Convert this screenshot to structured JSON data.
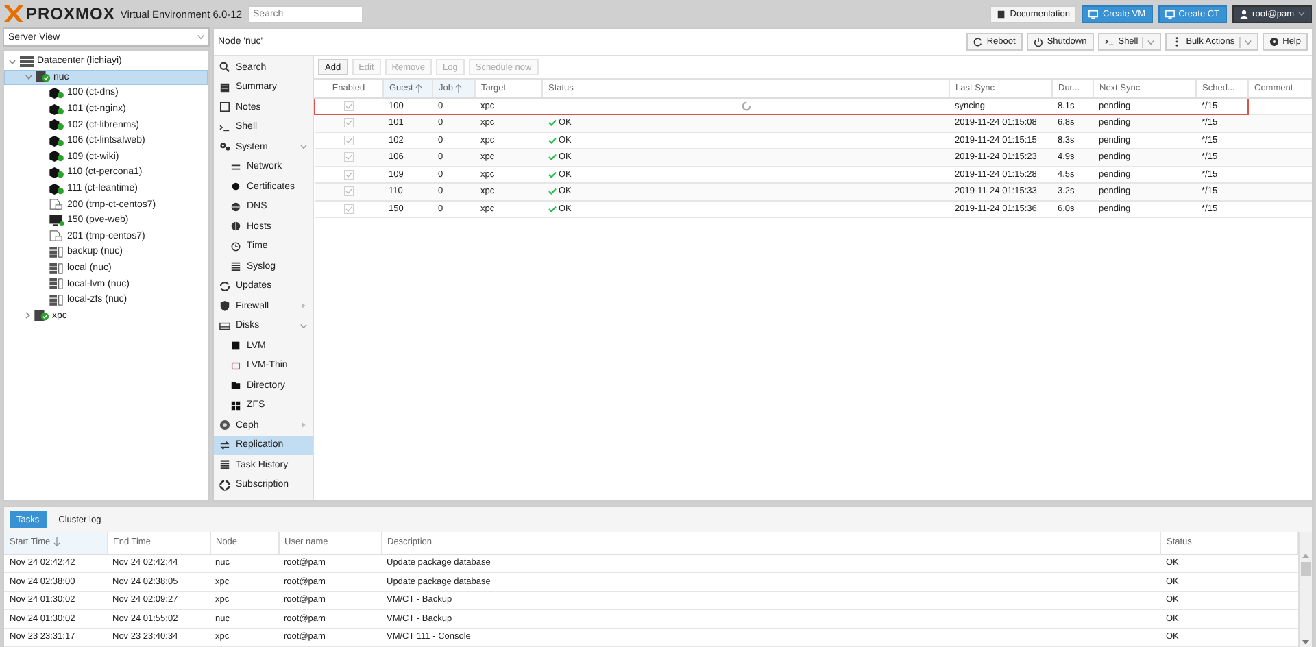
{
  "header": {
    "logo": "PROXMOX",
    "product": "Virtual Environment 6.0-12",
    "search": {
      "placeholder": "Search"
    },
    "buttons": [
      {
        "label": "Documentation",
        "kind": "plain"
      },
      {
        "label": "Create VM",
        "kind": "primary"
      },
      {
        "label": "Create CT",
        "kind": "primary"
      },
      {
        "label": "root@pam",
        "kind": "user"
      }
    ]
  },
  "tree": {
    "view": "Server View",
    "items": [
      {
        "label": "Datacenter (lichiayi)",
        "kind": "datacenter",
        "expanded": true,
        "selected": false,
        "children": [
          {
            "label": "nuc",
            "kind": "node",
            "expanded": true,
            "selected": true,
            "children": [
              {
                "label": "100 (ct-dns)",
                "kind": "ct",
                "selected": false
              },
              {
                "label": "101 (ct-nginx)",
                "kind": "ct",
                "selected": false
              },
              {
                "label": "102 (ct-librenms)",
                "kind": "ct",
                "selected": false
              },
              {
                "label": "106 (ct-lintsalweb)",
                "kind": "ct",
                "selected": false
              },
              {
                "label": "109 (ct-wiki)",
                "kind": "ct",
                "selected": false
              },
              {
                "label": "110 (ct-percona1)",
                "kind": "ct",
                "selected": false
              },
              {
                "label": "111 (ct-leantime)",
                "kind": "ct",
                "selected": false
              },
              {
                "label": "200 (tmp-ct-centos7)",
                "kind": "template",
                "selected": false
              },
              {
                "label": "150 (pve-web)",
                "kind": "vm",
                "selected": false
              },
              {
                "label": "201 (tmp-centos7)",
                "kind": "template",
                "selected": false
              },
              {
                "label": "backup (nuc)",
                "kind": "storage",
                "selected": false
              },
              {
                "label": "local (nuc)",
                "kind": "storage",
                "selected": false
              },
              {
                "label": "local-lvm (nuc)",
                "kind": "storage",
                "selected": false
              },
              {
                "label": "local-zfs (nuc)",
                "kind": "storage",
                "selected": false
              }
            ]
          },
          {
            "label": "xpc",
            "kind": "node",
            "expanded": false,
            "selected": false
          }
        ]
      }
    ]
  },
  "node": {
    "title": "Node 'nuc'",
    "buttons": [
      {
        "label": "Reboot",
        "menu": false
      },
      {
        "label": "Shutdown",
        "menu": false
      },
      {
        "label": "Shell",
        "menu": true
      },
      {
        "label": "Bulk Actions",
        "menu": true
      },
      {
        "label": "Help",
        "menu": false
      }
    ]
  },
  "nav": [
    {
      "label": "Search",
      "selected": false
    },
    {
      "label": "Summary",
      "selected": false
    },
    {
      "label": "Notes",
      "selected": false
    },
    {
      "label": "Shell",
      "selected": false
    },
    {
      "label": "System",
      "selected": false,
      "expanded": true,
      "children": [
        {
          "label": "Network",
          "selected": false
        },
        {
          "label": "Certificates",
          "selected": false
        },
        {
          "label": "DNS",
          "selected": false
        },
        {
          "label": "Hosts",
          "selected": false
        },
        {
          "label": "Time",
          "selected": false
        },
        {
          "label": "Syslog",
          "selected": false
        }
      ]
    },
    {
      "label": "Updates",
      "selected": false
    },
    {
      "label": "Firewall",
      "selected": false,
      "expanded": false
    },
    {
      "label": "Disks",
      "selected": false,
      "expanded": true,
      "children": [
        {
          "label": "LVM",
          "selected": false
        },
        {
          "label": "LVM-Thin",
          "selected": false
        },
        {
          "label": "Directory",
          "selected": false
        },
        {
          "label": "ZFS",
          "selected": false
        }
      ]
    },
    {
      "label": "Ceph",
      "selected": false,
      "expanded": false
    },
    {
      "label": "Replication",
      "selected": true
    },
    {
      "label": "Task History",
      "selected": false
    },
    {
      "label": "Subscription",
      "selected": false
    }
  ],
  "replication": {
    "toolbar": [
      {
        "label": "Add",
        "disabled": false
      },
      {
        "label": "Edit",
        "disabled": true
      },
      {
        "label": "Remove",
        "disabled": true
      },
      {
        "label": "Log",
        "disabled": true
      },
      {
        "label": "Schedule now",
        "disabled": true
      }
    ],
    "columns": [
      {
        "label": "Enabled",
        "sorted": false
      },
      {
        "label": "Guest",
        "sorted": true
      },
      {
        "label": "Job",
        "sorted": true
      },
      {
        "label": "Target",
        "sorted": false
      },
      {
        "label": "Status",
        "sorted": false
      },
      {
        "label": "Last Sync",
        "sorted": false
      },
      {
        "label": "Dur...",
        "sorted": false
      },
      {
        "label": "Next Sync",
        "sorted": false
      },
      {
        "label": "Sched...",
        "sorted": false
      },
      {
        "label": "Comment",
        "sorted": false
      }
    ],
    "rows": [
      {
        "enabled": true,
        "guest": "100",
        "job": "0",
        "target": "xpc",
        "status": {
          "kind": "syncing"
        },
        "last_sync": "syncing",
        "duration": "8.1s",
        "next_sync": "pending",
        "schedule": "*/15",
        "selected": true
      },
      {
        "enabled": true,
        "guest": "101",
        "job": "0",
        "target": "xpc",
        "status": {
          "kind": "ok",
          "text": "OK"
        },
        "last_sync": "2019-11-24 01:15:08",
        "duration": "6.8s",
        "next_sync": "pending",
        "schedule": "*/15",
        "selected": false
      },
      {
        "enabled": true,
        "guest": "102",
        "job": "0",
        "target": "xpc",
        "status": {
          "kind": "ok",
          "text": "OK"
        },
        "last_sync": "2019-11-24 01:15:15",
        "duration": "8.3s",
        "next_sync": "pending",
        "schedule": "*/15",
        "selected": false
      },
      {
        "enabled": true,
        "guest": "106",
        "job": "0",
        "target": "xpc",
        "status": {
          "kind": "ok",
          "text": "OK"
        },
        "last_sync": "2019-11-24 01:15:23",
        "duration": "4.9s",
        "next_sync": "pending",
        "schedule": "*/15",
        "selected": false
      },
      {
        "enabled": true,
        "guest": "109",
        "job": "0",
        "target": "xpc",
        "status": {
          "kind": "ok",
          "text": "OK"
        },
        "last_sync": "2019-11-24 01:15:28",
        "duration": "4.5s",
        "next_sync": "pending",
        "schedule": "*/15",
        "selected": false
      },
      {
        "enabled": true,
        "guest": "110",
        "job": "0",
        "target": "xpc",
        "status": {
          "kind": "ok",
          "text": "OK"
        },
        "last_sync": "2019-11-24 01:15:33",
        "duration": "3.2s",
        "next_sync": "pending",
        "schedule": "*/15",
        "selected": false
      },
      {
        "enabled": true,
        "guest": "150",
        "job": "0",
        "target": "xpc",
        "status": {
          "kind": "ok",
          "text": "OK"
        },
        "last_sync": "2019-11-24 01:15:36",
        "duration": "6.0s",
        "next_sync": "pending",
        "schedule": "*/15",
        "selected": false
      }
    ]
  },
  "tasks": {
    "tabs": [
      {
        "label": "Tasks",
        "selected": true
      },
      {
        "label": "Cluster log",
        "selected": false
      }
    ],
    "columns": [
      {
        "label": "Start Time",
        "sorted": true
      },
      {
        "label": "End Time",
        "sorted": false
      },
      {
        "label": "Node",
        "sorted": false
      },
      {
        "label": "User name",
        "sorted": false
      },
      {
        "label": "Description",
        "sorted": false
      },
      {
        "label": "Status",
        "sorted": false
      }
    ],
    "rows": [
      [
        "Nov 24 02:42:42",
        "Nov 24 02:42:44",
        "nuc",
        "root@pam",
        "Update package database",
        "OK"
      ],
      [
        "Nov 24 02:38:00",
        "Nov 24 02:38:05",
        "xpc",
        "root@pam",
        "Update package database",
        "OK"
      ],
      [
        "Nov 24 01:30:02",
        "Nov 24 02:09:27",
        "xpc",
        "root@pam",
        "VM/CT - Backup",
        "OK"
      ],
      [
        "Nov 24 01:30:02",
        "Nov 24 01:55:02",
        "nuc",
        "root@pam",
        "VM/CT - Backup",
        "OK"
      ],
      [
        "Nov 23 23:31:17",
        "Nov 23 23:40:34",
        "xpc",
        "root@pam",
        "VM/CT 111 - Console",
        "OK"
      ]
    ]
  }
}
